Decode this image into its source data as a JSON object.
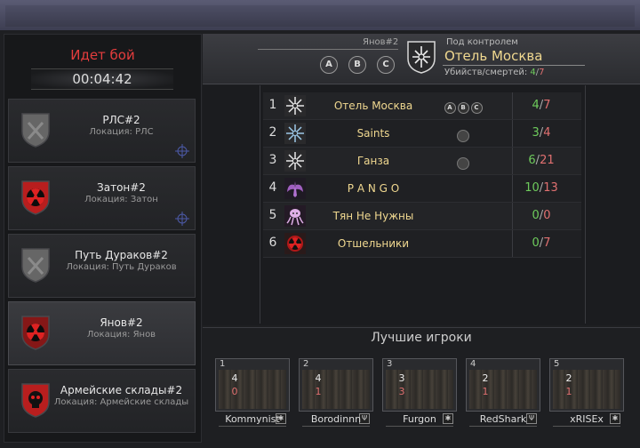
{
  "battle": {
    "status": "Идет бой",
    "timer": "00:04:42"
  },
  "locations": [
    {
      "name": "РЛС#2",
      "sub": "Локация: РЛС",
      "icon": "crossed-guns-icon",
      "color": "#6a6a6a",
      "crosshair": true,
      "active": false
    },
    {
      "name": "Затон#2",
      "sub": "Локация: Затон",
      "icon": "radiation-icon",
      "color": "#c01e1e",
      "crosshair": true,
      "active": false
    },
    {
      "name": "Путь Дураков#2",
      "sub": "Локация: Путь Дураков",
      "icon": "crossed-guns-icon",
      "color": "#6a6a6a",
      "crosshair": false,
      "active": false
    },
    {
      "name": "Янов#2",
      "sub": "Локация: Янов",
      "icon": "radiation-icon",
      "color": "#8a1616",
      "crosshair": false,
      "active": true
    },
    {
      "name": "Армейские склады#2",
      "sub": "Локация: Армейские склады",
      "icon": "skull-icon",
      "color": "#c01e1e",
      "crosshair": false,
      "active": false
    }
  ],
  "header": {
    "location": "Янов#2",
    "points": [
      "A",
      "B",
      "C"
    ],
    "control_label": "Под контролем",
    "control_name": "Отель Москва",
    "kd_label": "Убийств/смертей:",
    "kd_kills": "4",
    "kd_sep": "/",
    "kd_deaths": "7"
  },
  "standings": [
    {
      "rank": "1",
      "clan": "Отель Москва",
      "icon": "compass-star-icon",
      "tags": "abc",
      "kills": "4",
      "deaths": "7"
    },
    {
      "rank": "2",
      "clan": "Saints",
      "icon": "compass-star-blue-icon",
      "tags": "flag",
      "kills": "3",
      "deaths": "4"
    },
    {
      "rank": "3",
      "clan": "Ганза",
      "icon": "compass-star-icon",
      "tags": "flag",
      "kills": "6",
      "deaths": "21"
    },
    {
      "rank": "4",
      "clan": "P A N G O",
      "icon": "purple-wings-icon",
      "tags": "",
      "kills": "10",
      "deaths": "13"
    },
    {
      "rank": "5",
      "clan": "Тян Не Нужны",
      "icon": "octopus-icon",
      "tags": "",
      "kills": "0",
      "deaths": "0"
    },
    {
      "rank": "6",
      "clan": "Отшельники",
      "icon": "radiation-icon",
      "tags": "",
      "kills": "0",
      "deaths": "7"
    }
  ],
  "best": {
    "title": "Лучшие игроки",
    "players": [
      {
        "rank": "1",
        "name": "Kommynist",
        "kills": "4",
        "deaths": "0",
        "badge": "✱"
      },
      {
        "rank": "2",
        "name": "Borodinnn",
        "kills": "4",
        "deaths": "1",
        "badge": "Ψ"
      },
      {
        "rank": "3",
        "name": "Furgon",
        "kills": "3",
        "deaths": "3",
        "badge": "✱"
      },
      {
        "rank": "4",
        "name": "RedShark",
        "kills": "2",
        "deaths": "1",
        "badge": "Ψ"
      },
      {
        "rank": "5",
        "name": "xRISEx",
        "kills": "2",
        "deaths": "1",
        "badge": "✱"
      }
    ]
  }
}
